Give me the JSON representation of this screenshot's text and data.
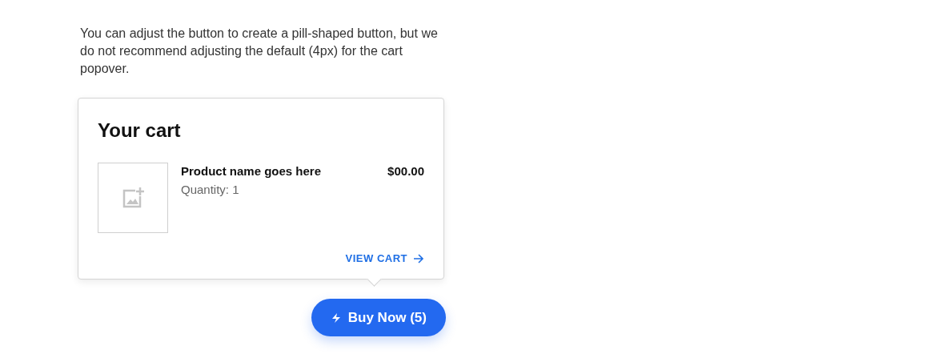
{
  "intro": "You can adjust the button to create a pill-shaped button, but we do not recommend adjusting the default (4px) for the cart popover.",
  "cart": {
    "title": "Your cart",
    "items": [
      {
        "name": "Product name goes here",
        "quantity": "Quantity: 1",
        "price": "$00.00"
      }
    ],
    "view_cart": "VIEW CART"
  },
  "buy_button": {
    "label": "Buy Now (5)"
  }
}
